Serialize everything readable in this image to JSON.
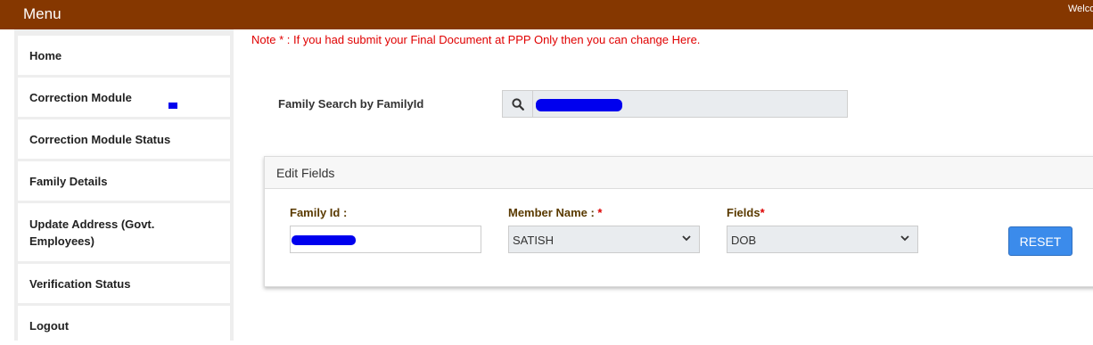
{
  "header": {
    "menu_title": "Menu",
    "welcome_text": "Welcome"
  },
  "sidebar": {
    "items": [
      {
        "label": "Home"
      },
      {
        "label": "Correction Module"
      },
      {
        "label": "Correction Module Status"
      },
      {
        "label": "Family Details"
      },
      {
        "label": "Update Address (Govt. Employees)"
      },
      {
        "label": "Verification Status"
      },
      {
        "label": "Logout"
      }
    ]
  },
  "note": "Note * : If you had submit your Final Document at PPP Only then you can change Here.",
  "search": {
    "label": "Family Search by FamilyId",
    "icon": "search-icon",
    "value": ""
  },
  "edit_fields": {
    "title": "Edit Fields",
    "family_id_label": "Family Id :",
    "family_id_value": "",
    "member_name_label": "Member Name : ",
    "member_name_value": "SATISH",
    "fields_label": "Fields",
    "fields_value": "DOB",
    "required_mark": "*",
    "reset_label": "RESET"
  },
  "colors": {
    "header_bg": "#853700",
    "note_text": "#e00000",
    "reset_button": "#3b8beb",
    "redaction": "#0000ee"
  }
}
